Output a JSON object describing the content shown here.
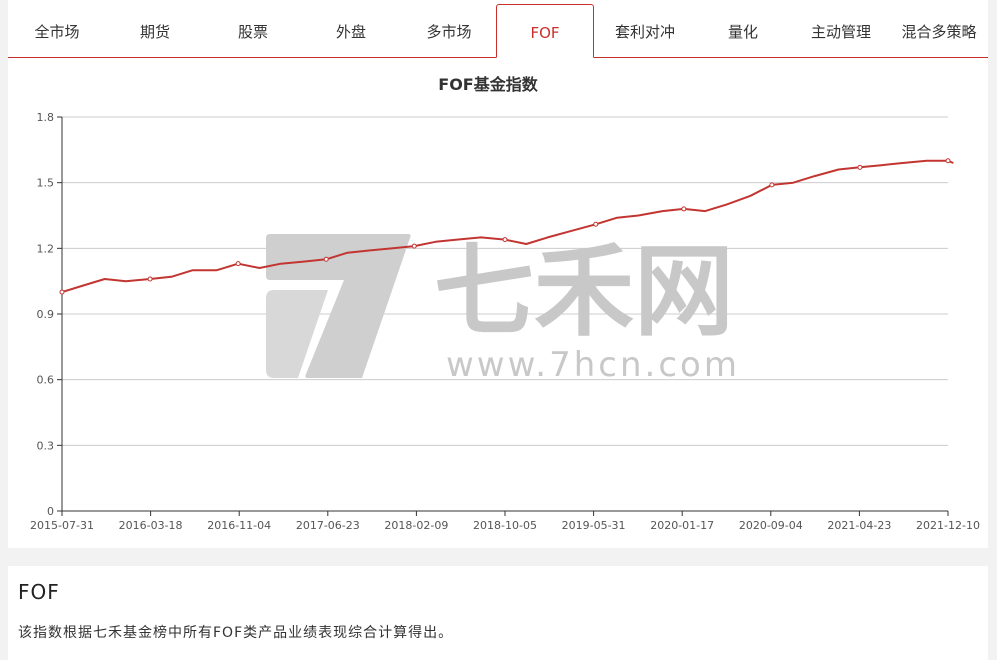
{
  "tabs": [
    {
      "label": "全市场",
      "active": false
    },
    {
      "label": "期货",
      "active": false
    },
    {
      "label": "股票",
      "active": false
    },
    {
      "label": "外盘",
      "active": false
    },
    {
      "label": "多市场",
      "active": false
    },
    {
      "label": "FOF",
      "active": true
    },
    {
      "label": "套利对冲",
      "active": false
    },
    {
      "label": "量化",
      "active": false
    },
    {
      "label": "主动管理",
      "active": false
    },
    {
      "label": "混合多策略",
      "active": false
    }
  ],
  "watermark": {
    "brand": "七禾网",
    "url": "www.7hcn.com"
  },
  "colors": {
    "accent": "#c9302c",
    "line": "#c23531",
    "grid": "#cccccc"
  },
  "chart_data": {
    "type": "line",
    "title": "FOF基金指数",
    "xlabel": "",
    "ylabel": "",
    "ylim": [
      0,
      1.8
    ],
    "yticks": [
      "0",
      "0.3",
      "0.6",
      "0.9",
      "1.2",
      "1.5",
      "1.8"
    ],
    "xticks": [
      "2015-07-31",
      "2016-03-18",
      "2016-11-04",
      "2017-06-23",
      "2018-02-09",
      "2018-10-05",
      "2019-05-31",
      "2020-01-17",
      "2020-09-04",
      "2021-04-23",
      "2021-12-10"
    ],
    "legend": "none",
    "grid": true,
    "series": [
      {
        "x": [
          "2015-07-31",
          "2015-09-25",
          "2015-11-20",
          "2016-01-15",
          "2016-03-18",
          "2016-05-13",
          "2016-07-08",
          "2016-09-09",
          "2016-11-04",
          "2016-12-30",
          "2017-02-24",
          "2017-04-28",
          "2017-06-23",
          "2017-08-18",
          "2017-10-13",
          "2017-12-15",
          "2018-02-09",
          "2018-04-06",
          "2018-06-01",
          "2018-08-03",
          "2018-10-05",
          "2018-11-30",
          "2019-01-25",
          "2019-03-29",
          "2019-05-31",
          "2019-07-26",
          "2019-09-20",
          "2019-11-22",
          "2020-01-17",
          "2020-03-13",
          "2020-05-08",
          "2020-07-10",
          "2020-09-04",
          "2020-10-30",
          "2020-12-25",
          "2021-02-26",
          "2021-04-23",
          "2021-06-18",
          "2021-08-13",
          "2021-10-15",
          "2021-12-10",
          "2021-12-24"
        ],
        "values": [
          1.0,
          1.03,
          1.06,
          1.05,
          1.06,
          1.07,
          1.1,
          1.1,
          1.13,
          1.11,
          1.13,
          1.14,
          1.15,
          1.18,
          1.19,
          1.2,
          1.21,
          1.23,
          1.24,
          1.25,
          1.24,
          1.22,
          1.25,
          1.28,
          1.31,
          1.34,
          1.35,
          1.37,
          1.38,
          1.37,
          1.4,
          1.44,
          1.49,
          1.5,
          1.53,
          1.56,
          1.57,
          1.58,
          1.59,
          1.6,
          1.6,
          1.59
        ]
      }
    ]
  },
  "description": {
    "title": "FOF",
    "text": "该指数根据七禾基金榜中所有FOF类产品业绩表现综合计算得出。"
  }
}
